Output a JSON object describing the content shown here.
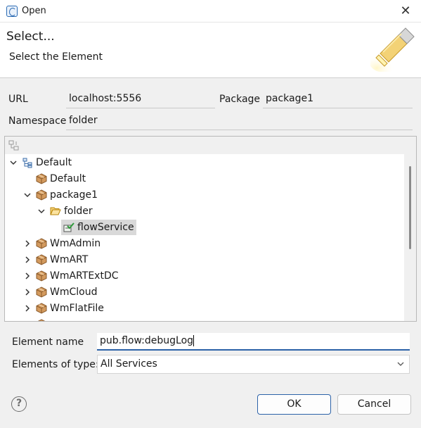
{
  "window": {
    "title": "Open",
    "close_glyph": "✕"
  },
  "banner": {
    "title": "Select...",
    "message": "Select the Element",
    "icon": "flashlight-icon"
  },
  "fields": {
    "url_label": "URL",
    "url_value": "localhost:5556",
    "package_label": "Package",
    "package_value": "package1",
    "namespace_label": "Namespace",
    "namespace_value": "folder"
  },
  "tree": {
    "items": [
      {
        "label": "Default",
        "icon": "server-icon",
        "expanded": true
      },
      {
        "label": "Default",
        "icon": "package-icon"
      },
      {
        "label": "package1",
        "icon": "package-icon",
        "expanded": true
      },
      {
        "label": "folder",
        "icon": "folder-open-icon",
        "expanded": true
      },
      {
        "label": "flowService",
        "icon": "flow-service-icon",
        "selected": true
      },
      {
        "label": "WmAdmin",
        "icon": "package-icon",
        "expanded": false
      },
      {
        "label": "WmART",
        "icon": "package-icon",
        "expanded": false
      },
      {
        "label": "WmARTExtDC",
        "icon": "package-icon",
        "expanded": false
      },
      {
        "label": "WmCloud",
        "icon": "package-icon",
        "expanded": false
      },
      {
        "label": "WmFlatFile",
        "icon": "package-icon",
        "expanded": false
      }
    ]
  },
  "form": {
    "element_name_label": "Element name",
    "element_name_value": "pub.flow:debugLog",
    "type_label": "Elements of type:",
    "type_value": "All Services"
  },
  "buttons": {
    "help": "?",
    "ok": "OK",
    "cancel": "Cancel"
  },
  "colors": {
    "accent": "#2c62a8",
    "package": "#b8824a",
    "folder": "#e0a82e",
    "flow_check": "#2e9b3a"
  }
}
